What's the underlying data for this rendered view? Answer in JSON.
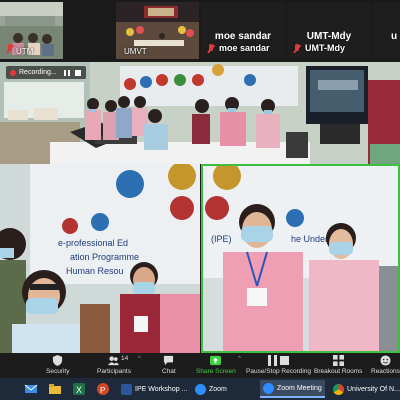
{
  "window": {
    "title": "Zoom Meeting"
  },
  "participants_strip": [
    {
      "name": "UTM",
      "type": "video",
      "muted": true
    },
    {
      "name": "UMVT",
      "type": "video",
      "muted": false
    },
    {
      "name": "moe sandar",
      "type": "name-only",
      "muted": true
    },
    {
      "name": "UMT-Mdy",
      "type": "name-only",
      "muted": true
    },
    {
      "name": "u",
      "type": "name-only",
      "muted": false
    }
  ],
  "recording": {
    "label": "Recording..."
  },
  "banner": {
    "text_line1": "e-professional Ed",
    "text_line2": "ation Programme",
    "text_line3": "Human Resou",
    "right_text1": "(IPE)",
    "right_text2": "he Undergrad"
  },
  "controls": {
    "security": "Security",
    "participants": "Participants",
    "participants_count": "14",
    "chat": "Chat",
    "share_screen": "Share Screen",
    "pause_stop_recording": "Pause/Stop Recording",
    "breakout_rooms": "Breakout Rooms",
    "reactions": "Reactions"
  },
  "taskbar": {
    "apps": [
      {
        "label": "IPE Workshop ...",
        "color": "#2b579a"
      },
      {
        "label": "Zoom",
        "color": "#2d8cff"
      },
      {
        "label": "Zoom Meeting",
        "color": "#2d8cff"
      },
      {
        "label": "University Of N...",
        "color": "#e8a317"
      }
    ]
  },
  "colors": {
    "accent_green": "#3fbf40",
    "record_red": "#e23b3b",
    "bar_bg": "#1c1c1c"
  }
}
